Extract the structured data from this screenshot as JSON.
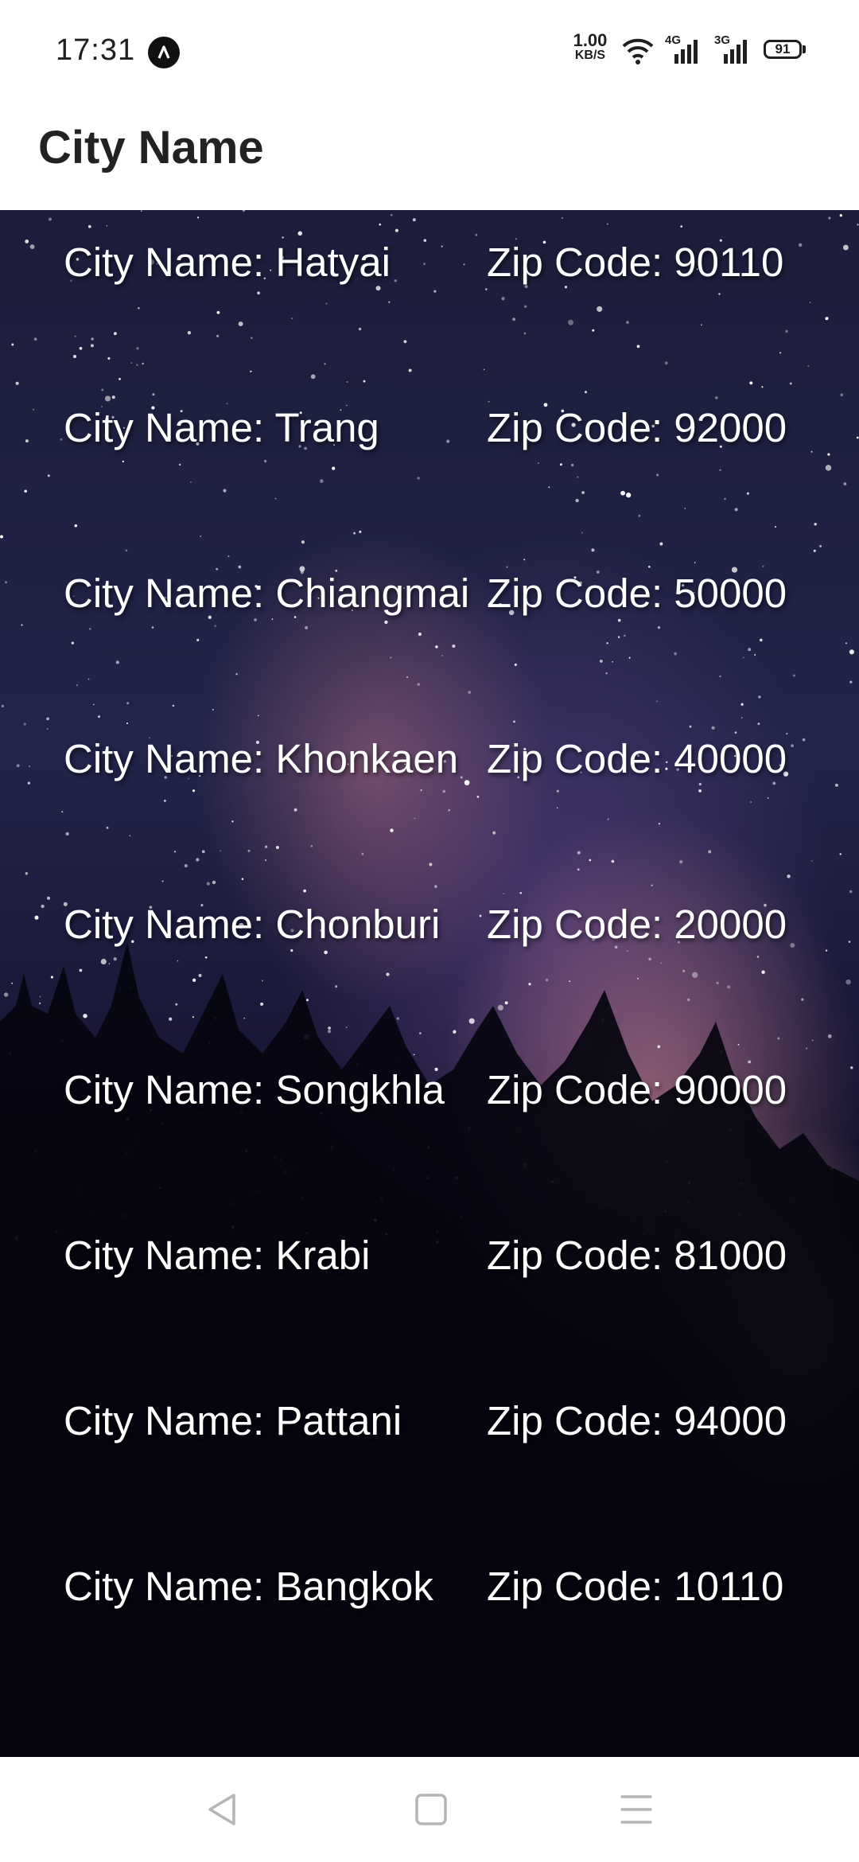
{
  "status_bar": {
    "time": "17:31",
    "net_speed_value": "1.00",
    "net_speed_unit": "KB/S",
    "network_4g": "4G",
    "network_3g": "3G",
    "battery": "91"
  },
  "app_bar": {
    "title": "City Name"
  },
  "cities": [
    {
      "city": "City Name: Hatyai",
      "zip": "Zip Code: 90110"
    },
    {
      "city": "City Name: Trang",
      "zip": "Zip Code: 92000"
    },
    {
      "city": "City Name: Chiangmai",
      "zip": "Zip Code: 50000"
    },
    {
      "city": "City Name: Khonkaen",
      "zip": "Zip Code: 40000"
    },
    {
      "city": "City Name: Chonburi",
      "zip": "Zip Code: 20000"
    },
    {
      "city": "City Name: Songkhla",
      "zip": "Zip Code: 90000"
    },
    {
      "city": "City Name: Krabi",
      "zip": "Zip Code: 81000"
    },
    {
      "city": "City Name: Pattani",
      "zip": "Zip Code: 94000"
    },
    {
      "city": "City Name: Bangkok",
      "zip": "Zip Code: 10110"
    }
  ],
  "icons": {
    "status_app": "navigation-arrow-icon",
    "wifi": "wifi-icon",
    "signal": "signal-bars-icon",
    "battery": "battery-icon",
    "back": "back-triangle-icon",
    "home": "home-square-icon",
    "menu": "menu-lines-icon"
  },
  "colors": {
    "list_text": "#ffffff",
    "title_text": "#222222",
    "nav_icon": "#b5b5b5"
  }
}
